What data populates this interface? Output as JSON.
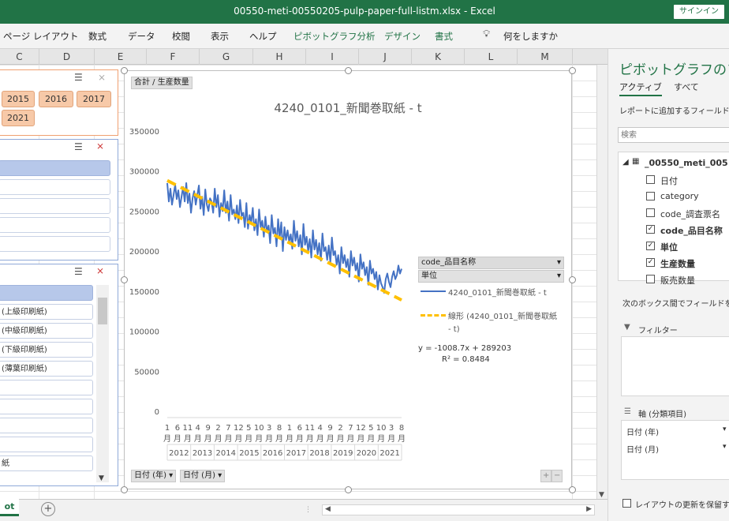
{
  "window": {
    "title": "00550-meti-00550205-pulp-paper-full-listm.xlsx  -  Excel",
    "signin": "サインイン"
  },
  "ribbon": {
    "tabs": [
      "ページ レイアウト",
      "数式",
      "データ",
      "校閲",
      "表示",
      "ヘルプ"
    ],
    "context_tabs": [
      "ピボットグラフ分析",
      "デザイン",
      "書式"
    ],
    "tell_me": "何をしますか",
    "tell_me_icon": "lightbulb-icon"
  },
  "columns": [
    "C",
    "D",
    "E",
    "F",
    "G",
    "H",
    "I",
    "J",
    "K",
    "L",
    "M"
  ],
  "slicer_year": {
    "buttons": [
      "2015",
      "2016",
      "2017",
      "2021"
    ]
  },
  "slicer_product": {
    "items": [
      "(上級印刷紙)",
      "(中級印刷紙)",
      "(下級印刷紙)",
      "(薄葉印刷紙)",
      "紙"
    ]
  },
  "chart": {
    "value_field_button": "合計 / 生産数量",
    "axis_buttons": [
      "日付 (年)",
      "日付 (月)"
    ],
    "legend_field_1": "code_品目名称",
    "legend_field_2": "単位",
    "legend_series": "4240_0101_新聞巻取紙 - t",
    "legend_trend_line1": "線形 (4240_0101_新聞巻取",
    "legend_trend_line2": "紙",
    "legend_trend_line3": "- t)",
    "equation": "y = -1008.7x + 289203",
    "r2": "R² = 0.8484",
    "zoom_plus": "+",
    "zoom_minus": "−"
  },
  "chart_data": {
    "type": "line",
    "title": "4240_0101_新聞巻取紙 - t",
    "ylim": [
      0,
      350000
    ],
    "yticks": [
      0,
      50000,
      100000,
      150000,
      200000,
      250000,
      300000,
      350000
    ],
    "x_month_labels": [
      "1",
      "6",
      "11",
      "4",
      "9",
      "2",
      "7",
      "12",
      "5",
      "10",
      "3",
      "8",
      "1",
      "6",
      "11",
      "4",
      "9",
      "2",
      "7",
      "12",
      "5",
      "10",
      "3",
      "8"
    ],
    "x_year_labels": [
      "2012",
      "2013",
      "2014",
      "2015",
      "2016",
      "2017",
      "2018",
      "2019",
      "2020",
      "2021"
    ],
    "series": [
      {
        "name": "4240_0101_新聞巻取紙 - t",
        "color": "#4472C4",
        "values": [
          285000,
          262000,
          278000,
          258000,
          270000,
          283000,
          265000,
          276000,
          255000,
          268000,
          280000,
          262000,
          285000,
          260000,
          272000,
          248000,
          266000,
          275000,
          258000,
          270000,
          282000,
          253000,
          268000,
          245000,
          277000,
          258000,
          250000,
          266000,
          262000,
          248000,
          278000,
          255000,
          270000,
          243000,
          260000,
          250000,
          276000,
          248000,
          262000,
          238000,
          270000,
          246000,
          252000,
          240000,
          257000,
          235000,
          264000,
          244000,
          248000,
          230000,
          260000,
          228000,
          245000,
          236000,
          254000,
          226000,
          240000,
          220000,
          252000,
          230000,
          238000,
          218000,
          243000,
          224000,
          232000,
          210000,
          245000,
          222000,
          229000,
          206000,
          240000,
          217000,
          236000,
          200000,
          230000,
          214000,
          226000,
          212000,
          221000,
          203000,
          238000,
          213000,
          225000,
          206000,
          220000,
          196000,
          234000,
          208000,
          218000,
          200000,
          215000,
          192000,
          226000,
          202000,
          214000,
          196000,
          210000,
          188000,
          222000,
          200000,
          205000,
          189000,
          207000,
          186000,
          217000,
          195000,
          200000,
          183000,
          195000,
          172000,
          205000,
          185000,
          195000,
          180000,
          190000,
          168000,
          200000,
          182000,
          192000,
          176000,
          185000,
          162000,
          196000,
          178000,
          186000,
          170000,
          180000,
          158000,
          188000,
          172000,
          178000,
          165000,
          174000,
          152000,
          170000,
          160000,
          155000,
          148000,
          165000,
          172000,
          162000,
          155000,
          168000,
          175000,
          165000,
          170000,
          182000,
          172000,
          178000
        ]
      },
      {
        "name": "線形 (4240_0101_新聞巻取紙 - t)",
        "color": "#FFC000",
        "trendline": {
          "slope": -1008.7,
          "intercept": 289203
        }
      }
    ]
  },
  "pivot_pane": {
    "title": "ピボットグラフのフィ",
    "tab_active": "アクティブ",
    "tab_all": "すべて",
    "hint": "レポートに追加するフィールドを選",
    "search_placeholder": "検索",
    "table_name": "_00550_meti_005",
    "fields": [
      {
        "label": "日付",
        "checked": false,
        "bold": false
      },
      {
        "label": "category",
        "checked": false,
        "bold": false
      },
      {
        "label": "code_調査票名",
        "checked": false,
        "bold": false
      },
      {
        "label": "code_品目名称",
        "checked": true,
        "bold": true
      },
      {
        "label": "単位",
        "checked": true,
        "bold": true
      },
      {
        "label": "生産数量",
        "checked": true,
        "bold": true
      },
      {
        "label": "販売数量",
        "checked": false,
        "bold": false
      }
    ],
    "drag_hint": "次のボックス間でフィールドをドラ",
    "filter_label": "フィルター",
    "axis_label": "軸 (分類項目)",
    "axis_items": [
      "日付 (年)",
      "日付 (月)"
    ],
    "defer_label": "レイアウトの更新を保留する"
  },
  "sheet_tabs": {
    "active": "ot",
    "add": "+"
  }
}
